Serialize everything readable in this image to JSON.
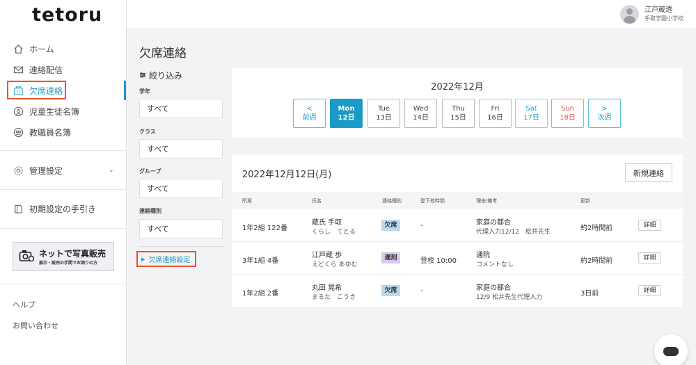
{
  "app": {
    "logo_text": "tetoru"
  },
  "sidebar": {
    "items": [
      {
        "label": "ホーム",
        "icon": "home-icon"
      },
      {
        "label": "連絡配信",
        "icon": "mail-icon"
      },
      {
        "label": "欠席連絡",
        "icon": "building-icon"
      },
      {
        "label": "児童生徒名簿",
        "icon": "student-icon"
      },
      {
        "label": "教職員名簿",
        "icon": "staff-icon"
      }
    ],
    "settings_label": "管理設定",
    "guide_label": "初期設定の手引き",
    "banner_title": "ネットで写真販売",
    "banner_sub": "展示・販売の手間でお困りの方",
    "help_label": "ヘルプ",
    "contact_label": "お問い合わせ"
  },
  "header": {
    "user_name": "江戸蔵透",
    "school": "手取学園小学校"
  },
  "page": {
    "title": "欠席連絡"
  },
  "filters": {
    "title": "絞り込み",
    "grade_label": "学年",
    "grade_value": "すべて",
    "class_label": "クラス",
    "class_value": "すべて",
    "group_label": "グループ",
    "group_value": "すべて",
    "type_label": "連絡種別",
    "type_value": "すべて",
    "settings_link": "欠席連絡設定"
  },
  "calendar": {
    "month": "2022年12月",
    "prev": {
      "top": "<",
      "bottom": "前週"
    },
    "next": {
      "top": ">",
      "bottom": "次週"
    },
    "days": [
      {
        "dow": "Mon",
        "date": "12日",
        "kind": "sel"
      },
      {
        "dow": "Tue",
        "date": "13日",
        "kind": ""
      },
      {
        "dow": "Wed",
        "date": "14日",
        "kind": ""
      },
      {
        "dow": "Thu",
        "date": "15日",
        "kind": ""
      },
      {
        "dow": "Fri",
        "date": "16日",
        "kind": ""
      },
      {
        "dow": "Sat",
        "date": "17日",
        "kind": "sat"
      },
      {
        "dow": "Sun",
        "date": "18日",
        "kind": "sun"
      }
    ]
  },
  "list": {
    "date_title": "2022年12月12日(月)",
    "new_button": "新規連絡",
    "columns": [
      "所属",
      "氏名",
      "連絡種別",
      "登下校時間",
      "理由/備考",
      "更新"
    ],
    "rows": [
      {
        "class": "1年2組 122番",
        "name": "蔵氏 手取",
        "kana": "くらし　てとる",
        "type": "欠席",
        "type_kind": "absent",
        "time": "-",
        "reason": "家庭の都合",
        "note": "代理入力12/12　松井先生",
        "updated": "約2時間前",
        "detail": "詳細"
      },
      {
        "class": "3年1組 4番",
        "name": "江戸蔵 歩",
        "kana": "えどくら あゆむ",
        "type": "遅刻",
        "type_kind": "late",
        "time": "登校 10:00",
        "reason": "通院",
        "note": "コメントなし",
        "updated": "約2時間前",
        "detail": "詳細"
      },
      {
        "class": "1年2組 2番",
        "name": "丸田 晃希",
        "kana": "まるた　こうき",
        "type": "欠席",
        "type_kind": "absent",
        "time": "-",
        "reason": "家庭の都合",
        "note": "12/9 松井先生代理入力",
        "updated": "3日前",
        "detail": "詳細"
      }
    ]
  },
  "colors": {
    "accent": "#1a9bc7",
    "highlight": "#e8542f",
    "absent_badge": "#b9d9f0",
    "late_badge": "#d9c9ef"
  }
}
